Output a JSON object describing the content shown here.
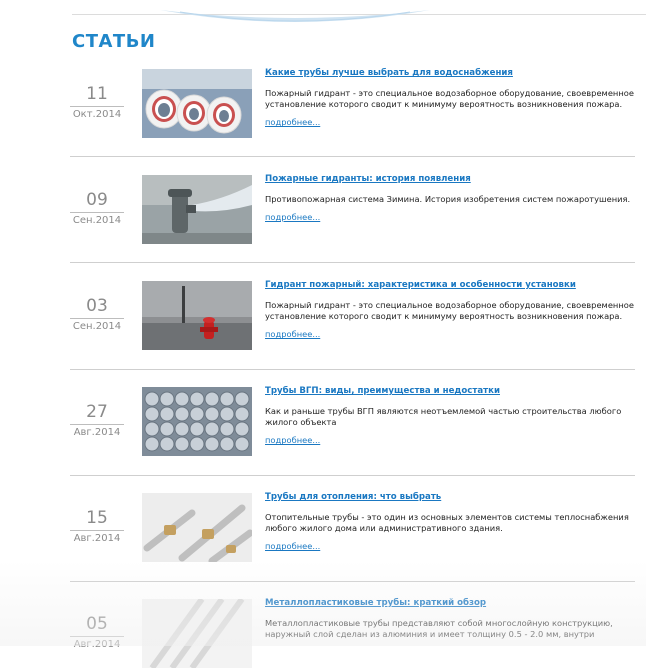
{
  "section": {
    "title": "СТАТЬИ"
  },
  "more_label": "подробнее...",
  "colors": {
    "link": "#1a78c2",
    "title": "#1f86c9",
    "date": "#8a8a8a"
  },
  "articles": [
    {
      "day": "11",
      "month": "Окт.2014",
      "title": "Какие трубы лучше выбрать для водоснабжения",
      "excerpt": "Пожарный гидрант - это специальное водозаборное оборудование, своевременное установление которого сводит к минимуму вероятность возникновения пожара.",
      "image": "white-pipes-image"
    },
    {
      "day": "09",
      "month": "Сен.2014",
      "title": "Пожарные гидранты: история появления",
      "excerpt": "Противопожарная система Зимина. История изобретения систем пожаротушения.",
      "image": "hydrant-spraying-image"
    },
    {
      "day": "03",
      "month": "Сен.2014",
      "title": "Гидрант пожарный: характеристика и особенности установки",
      "excerpt": "Пожарный гидрант - это специальное водозаборное оборудование, своевременное установление которого сводит к минимуму вероятность возникновения пожара.",
      "image": "red-hydrant-street-image"
    },
    {
      "day": "27",
      "month": "Авг.2014",
      "title": "Трубы ВГП: виды, преимущества и недостатки",
      "excerpt": "Как и раньше трубы ВГП являются неотъемлемой частью строительства любого жилого объекта",
      "image": "steel-pipes-stack-image"
    },
    {
      "day": "15",
      "month": "Авг.2014",
      "title": "Трубы для отопления: что выбрать",
      "excerpt": "Отопительные трубы - это один из основных элементов системы теплоснабжения любого жилого дома или административного здания.",
      "image": "heating-pipe-fittings-image"
    },
    {
      "day": "05",
      "month": "Авг.2014",
      "title": "Металлопластиковые трубы: краткий обзор",
      "excerpt": "Металлопластиковые трубы представляют собой многослойную конструкцию, наружный слой сделан из алюминия и имеет толщину 0.5 - 2.0 мм, внутри",
      "image": "metal-plastic-pipes-image"
    }
  ]
}
